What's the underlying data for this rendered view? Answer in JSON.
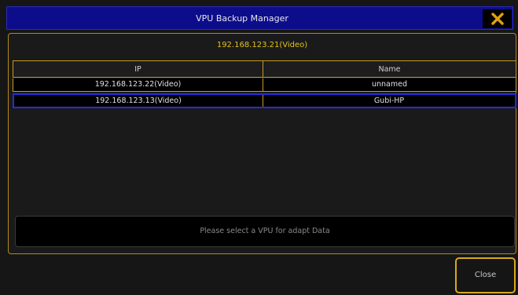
{
  "window": {
    "title": "VPU Backup Manager",
    "close_icon": "close-x-icon",
    "accent": "#e2a014"
  },
  "panel": {
    "subtitle": "192.168.123.21(Video)",
    "table": {
      "headers": [
        "IP",
        "Name"
      ],
      "rows": [
        {
          "ip": "192.168.123.22(Video)",
          "name": "unnamed",
          "selected": false
        },
        {
          "ip": "192.168.123.13(Video)",
          "name": "Gubi-HP",
          "selected": true
        }
      ]
    },
    "message": "Please select a VPU for adapt Data"
  },
  "footer": {
    "close_label": "Close"
  }
}
